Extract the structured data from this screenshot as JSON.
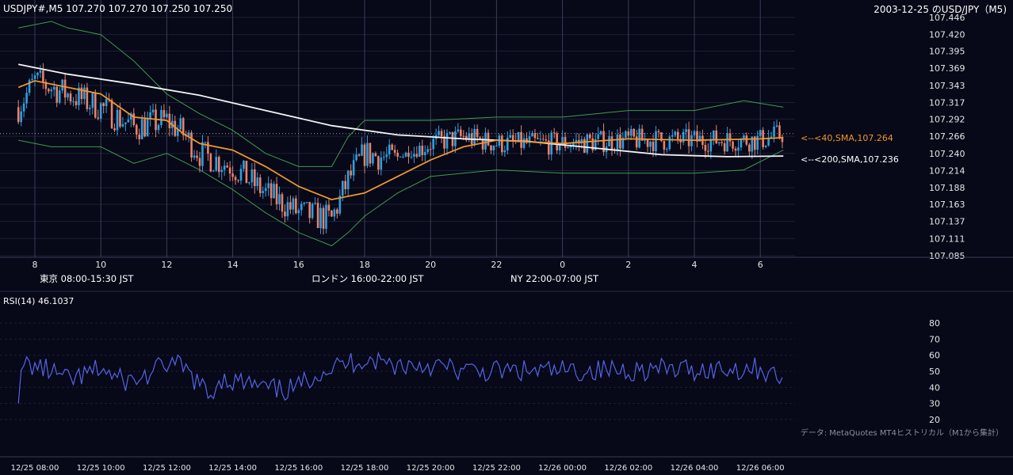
{
  "header": {
    "symbol_ohlc": "USDJPY#,M5 107.270 107.270 107.250 107.250",
    "title_right": "2003-12-25 のUSD/JPY（M5)"
  },
  "sessions": [
    {
      "label": "東京 08:00-15:30 JST",
      "color": "#255381"
    },
    {
      "label": "ロンドン 16:00-22:00 JST",
      "color": "#8a5a12"
    },
    {
      "label": "NY 22:00-07:00 JST",
      "color": "#236440"
    }
  ],
  "ma_labels": {
    "sma40": "<--<40,SMA,107.264",
    "sma200": "<--<200,SMA,107.236"
  },
  "rsi": {
    "label": "RSI(14) 46.1037"
  },
  "footer_note": "データ: MetaQuotes MT4ヒストリカル（M1から集計）",
  "colors": {
    "bull": "#2f9fe0",
    "bear": "#e8826a",
    "sma40": "#f0962b",
    "sma200": "#f4f4f4",
    "bollinger": "#3f9b4c",
    "rsi": "#5564e6",
    "grid": "#1c2035",
    "vgrid": "#3a3e56"
  },
  "chart_data": {
    "type": "candlestick",
    "symbol": "USDJPY",
    "timeframe": "M5",
    "price_axis_ticks": [
      "107.446",
      "107.420",
      "107.395",
      "107.369",
      "107.343",
      "107.317",
      "107.292",
      "107.266",
      "107.240",
      "107.214",
      "107.188",
      "107.163",
      "107.137",
      "107.111",
      "107.085"
    ],
    "price_ylim": [
      107.085,
      107.446
    ],
    "hour_ticks": [
      "8",
      "10",
      "12",
      "14",
      "16",
      "18",
      "20",
      "22",
      "0",
      "2",
      "4",
      "6"
    ],
    "date_ticks": [
      "12/25 08:00",
      "12/25 10:00",
      "12/25 12:00",
      "12/25 14:00",
      "12/25 16:00",
      "12/25 18:00",
      "12/25 20:00",
      "12/25 22:00",
      "12/26 00:00",
      "12/26 02:00",
      "12/26 04:00",
      "12/26 06:00"
    ],
    "x_range_hours": [
      7.5,
      30.7
    ],
    "current_price": 107.27,
    "sma40_last": 107.264,
    "sma200_last": 107.236,
    "sma40_path": [
      [
        7.5,
        107.34
      ],
      [
        8.0,
        107.35
      ],
      [
        9.0,
        107.34
      ],
      [
        10.0,
        107.33
      ],
      [
        11.0,
        107.295
      ],
      [
        12.0,
        107.29
      ],
      [
        12.5,
        107.27
      ],
      [
        13.0,
        107.255
      ],
      [
        14.0,
        107.245
      ],
      [
        15.0,
        107.22
      ],
      [
        16.0,
        107.19
      ],
      [
        17.0,
        107.17
      ],
      [
        18.0,
        107.18
      ],
      [
        19.0,
        107.205
      ],
      [
        20.0,
        107.23
      ],
      [
        21.0,
        107.25
      ],
      [
        22.0,
        107.26
      ],
      [
        24.0,
        107.255
      ],
      [
        26.0,
        107.262
      ],
      [
        28.0,
        107.26
      ],
      [
        30.0,
        107.262
      ],
      [
        30.7,
        107.264
      ]
    ],
    "sma200_path": [
      [
        7.5,
        107.375
      ],
      [
        9.0,
        107.36
      ],
      [
        11.0,
        107.345
      ],
      [
        13.0,
        107.328
      ],
      [
        15.0,
        107.305
      ],
      [
        17.0,
        107.282
      ],
      [
        19.0,
        107.268
      ],
      [
        21.0,
        107.262
      ],
      [
        23.0,
        107.258
      ],
      [
        25.0,
        107.248
      ],
      [
        27.0,
        107.238
      ],
      [
        29.0,
        107.235
      ],
      [
        30.7,
        107.236
      ]
    ],
    "bb_upper_path": [
      [
        7.5,
        107.43
      ],
      [
        8.5,
        107.44
      ],
      [
        9.0,
        107.43
      ],
      [
        10.0,
        107.42
      ],
      [
        11.0,
        107.38
      ],
      [
        12.0,
        107.33
      ],
      [
        13.0,
        107.3
      ],
      [
        14.0,
        107.275
      ],
      [
        15.0,
        107.24
      ],
      [
        16.0,
        107.22
      ],
      [
        17.0,
        107.22
      ],
      [
        17.5,
        107.265
      ],
      [
        18.0,
        107.29
      ],
      [
        19.0,
        107.29
      ],
      [
        20.0,
        107.29
      ],
      [
        22.0,
        107.295
      ],
      [
        24.0,
        107.295
      ],
      [
        26.0,
        107.305
      ],
      [
        28.0,
        107.305
      ],
      [
        29.5,
        107.32
      ],
      [
        30.7,
        107.31
      ]
    ],
    "bb_lower_path": [
      [
        7.5,
        107.26
      ],
      [
        8.5,
        107.25
      ],
      [
        9.0,
        107.25
      ],
      [
        10.0,
        107.25
      ],
      [
        11.0,
        107.225
      ],
      [
        12.0,
        107.24
      ],
      [
        13.0,
        107.215
      ],
      [
        14.0,
        107.185
      ],
      [
        15.0,
        107.15
      ],
      [
        16.0,
        107.12
      ],
      [
        17.0,
        107.1
      ],
      [
        17.5,
        107.12
      ],
      [
        18.0,
        107.145
      ],
      [
        19.0,
        107.18
      ],
      [
        20.0,
        107.205
      ],
      [
        22.0,
        107.215
      ],
      [
        24.0,
        107.21
      ],
      [
        26.0,
        107.21
      ],
      [
        28.0,
        107.21
      ],
      [
        29.5,
        107.215
      ],
      [
        30.7,
        107.245
      ]
    ],
    "price_anchors": [
      [
        7.5,
        107.31
      ],
      [
        8.0,
        107.35
      ],
      [
        9.0,
        107.33
      ],
      [
        10.0,
        107.31
      ],
      [
        11.0,
        107.28
      ],
      [
        12.0,
        107.29
      ],
      [
        12.5,
        107.27
      ],
      [
        13.0,
        107.24
      ],
      [
        14.0,
        107.22
      ],
      [
        15.0,
        107.18
      ],
      [
        16.0,
        107.15
      ],
      [
        17.0,
        107.14
      ],
      [
        17.5,
        107.2
      ],
      [
        18.0,
        107.24
      ],
      [
        19.0,
        107.23
      ],
      [
        20.0,
        107.255
      ],
      [
        21.0,
        107.265
      ],
      [
        22.0,
        107.255
      ],
      [
        24.0,
        107.255
      ],
      [
        26.0,
        107.26
      ],
      [
        28.0,
        107.26
      ],
      [
        30.0,
        107.26
      ],
      [
        30.7,
        107.27
      ]
    ],
    "rsi_axis_ticks": [
      "80",
      "70",
      "60",
      "50",
      "40",
      "30",
      "20"
    ],
    "rsi_ylim": [
      17,
      85
    ],
    "rsi_last": 46.1037,
    "rsi_anchors": [
      [
        7.5,
        37
      ],
      [
        7.7,
        55
      ],
      [
        8.0,
        53
      ],
      [
        8.5,
        50
      ],
      [
        9.0,
        44
      ],
      [
        9.5,
        47
      ],
      [
        10.0,
        52
      ],
      [
        10.5,
        45
      ],
      [
        11.0,
        44
      ],
      [
        11.5,
        48
      ],
      [
        12.0,
        55
      ],
      [
        12.5,
        52
      ],
      [
        13.0,
        42
      ],
      [
        13.3,
        33
      ],
      [
        13.6,
        46
      ],
      [
        14.0,
        44
      ],
      [
        14.5,
        42
      ],
      [
        15.0,
        39
      ],
      [
        15.5,
        38
      ],
      [
        16.0,
        40
      ],
      [
        16.5,
        49
      ],
      [
        17.0,
        52
      ],
      [
        17.5,
        55
      ],
      [
        18.0,
        58
      ],
      [
        19.0,
        54
      ],
      [
        20.0,
        54
      ],
      [
        21.0,
        50
      ],
      [
        22.0,
        50
      ],
      [
        24.0,
        50
      ],
      [
        26.0,
        51
      ],
      [
        28.0,
        51
      ],
      [
        30.0,
        52
      ],
      [
        30.3,
        48
      ],
      [
        30.7,
        46
      ]
    ]
  }
}
